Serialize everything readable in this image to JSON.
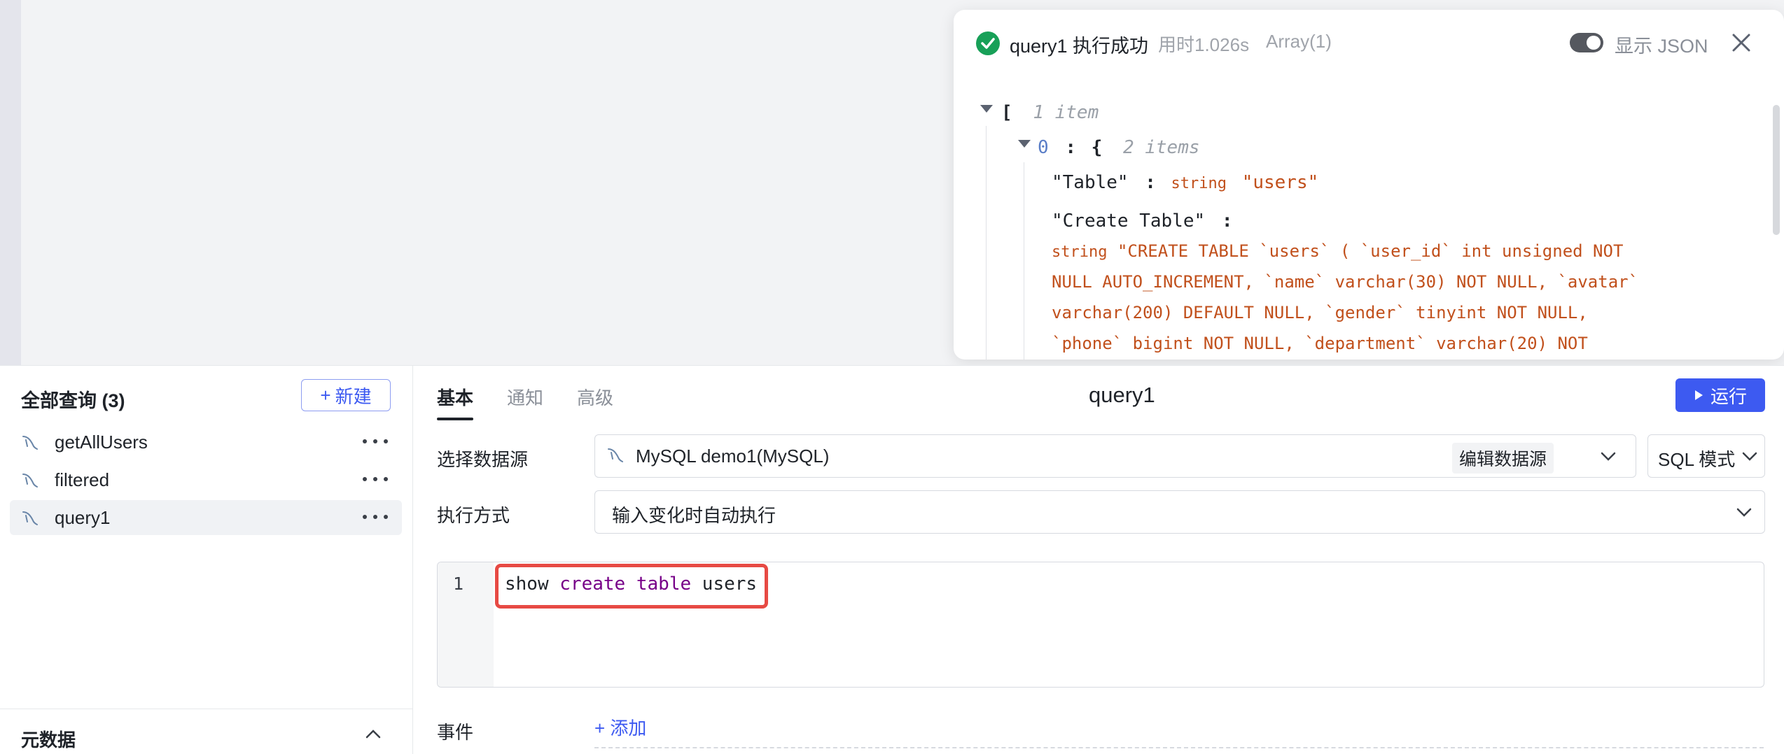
{
  "result_panel": {
    "title": "query1 执行成功",
    "time": "用时1.026s",
    "type": "Array(1)",
    "toggle_label": "显示 JSON",
    "toggle_on": true,
    "json": {
      "root_bracket": "[",
      "root_meta": "1 item",
      "item_index": "0",
      "item_colon": ":",
      "item_brace": "{",
      "item_meta": "2 items",
      "fields": [
        {
          "key": "\"Table\"",
          "colon": ":",
          "type": "string",
          "value": "\"users\""
        },
        {
          "key": "\"Create Table\"",
          "colon": ":",
          "type": "string",
          "value_lines": [
            "\"CREATE TABLE `users` ( `user_id` int unsigned NOT",
            "NULL AUTO_INCREMENT, `name` varchar(30) NOT NULL, `avatar`",
            "varchar(200) DEFAULT NULL, `gender` tinyint NOT NULL,",
            "`phone` bigint NOT NULL, `department` varchar(20) NOT"
          ]
        }
      ]
    }
  },
  "sidebar": {
    "title": "全部查询 (3)",
    "new_label": "新建",
    "new_plus": "+",
    "queries": [
      {
        "label": "getAllUsers",
        "active": false
      },
      {
        "label": "filtered",
        "active": false
      },
      {
        "label": "query1",
        "active": true
      }
    ],
    "metadata_label": "元数据"
  },
  "editor_panel": {
    "tabs": [
      "基本",
      "通知",
      "高级"
    ],
    "active_tab": "基本",
    "query_name": "query1",
    "run_label": "运行",
    "datasource_label": "选择数据源",
    "datasource_value": "MySQL demo1(MySQL)",
    "edit_datasource": "编辑数据源",
    "mode_value": "SQL 模式",
    "exec_label": "执行方式",
    "exec_value": "输入变化时自动执行",
    "line_number": "1",
    "code": {
      "w1": "show",
      "w2": "create",
      "w3": "table",
      "w4": "users"
    },
    "events_label": "事件",
    "add_label": "+ 添加"
  },
  "colors": {
    "accent": "#3d5af1",
    "success": "#18a058",
    "highlight": "#e74a44",
    "string": "#c1501c"
  }
}
